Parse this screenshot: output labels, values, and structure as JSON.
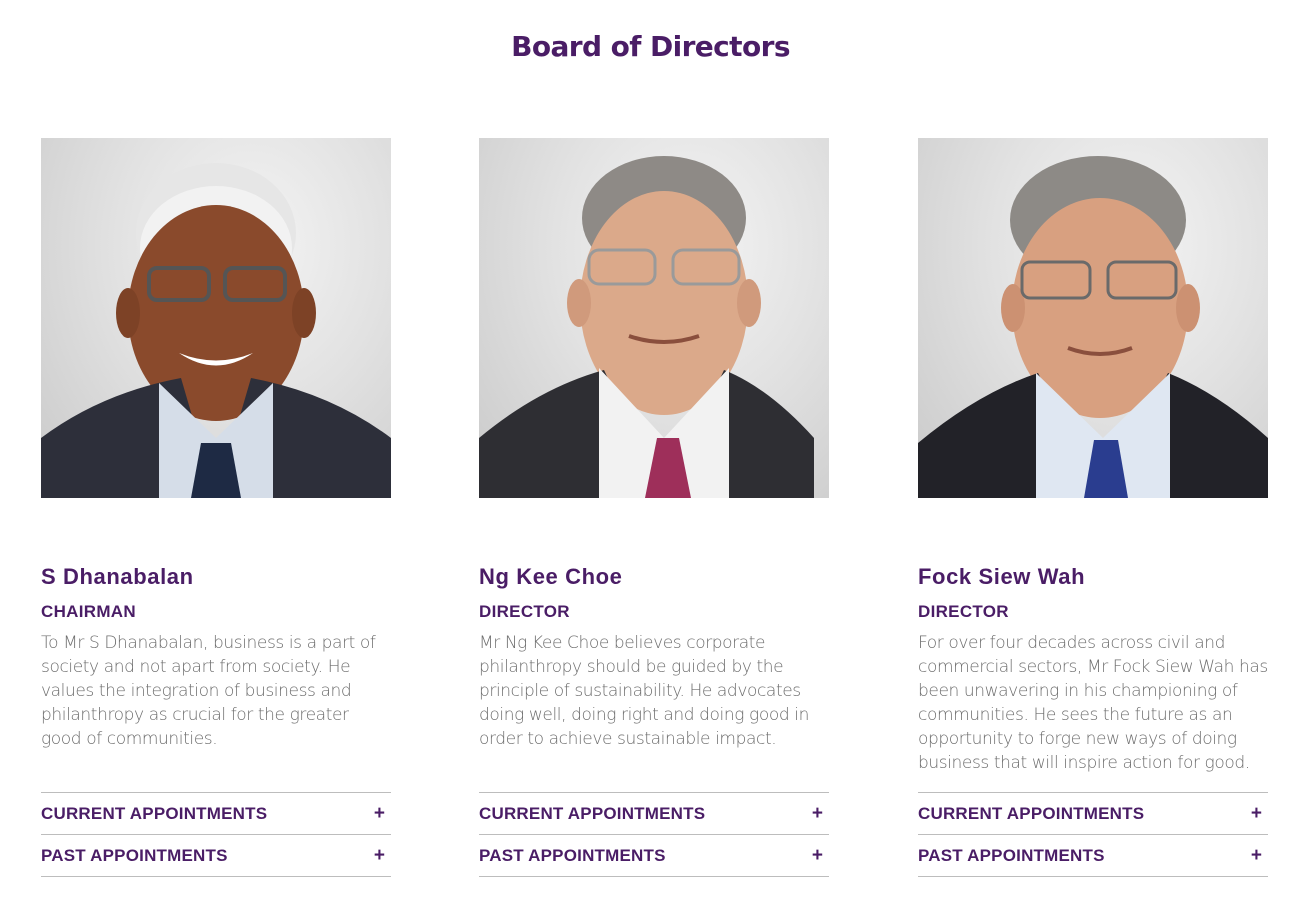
{
  "page": {
    "title": "Board of Directors"
  },
  "directors": [
    {
      "name": "S Dhanabalan",
      "role": "CHAIRMAN",
      "bio": "To Mr S Dhanabalan, business is a part of society and not apart from society. He values the integration of business and philanthropy as crucial for the greater good of communities.",
      "current_label": "CURRENT APPOINTMENTS",
      "past_label": "PAST APPOINTMENTS",
      "toggle_icon": "+"
    },
    {
      "name": "Ng Kee Choe",
      "role": "DIRECTOR",
      "bio": "Mr Ng Kee Choe believes corporate philanthropy should be guided by the principle of sustainability. He advocates doing well, doing right and doing good in order to achieve sustainable impact.",
      "current_label": "CURRENT APPOINTMENTS",
      "past_label": "PAST APPOINTMENTS",
      "toggle_icon": "+"
    },
    {
      "name": "Fock Siew Wah",
      "role": "DIRECTOR",
      "bio": "For over four decades across civil and commercial sectors, Mr Fock Siew Wah has been unwavering in his championing of communities. He sees the future as an opportunity to forge new ways of doing business that will inspire action for good.",
      "current_label": "CURRENT APPOINTMENTS",
      "past_label": "PAST APPOINTMENTS",
      "toggle_icon": "+"
    }
  ],
  "colors": {
    "brand_purple": "#4a1d66",
    "body_text": "#6d6d6d",
    "divider": "#bdbdbd"
  }
}
